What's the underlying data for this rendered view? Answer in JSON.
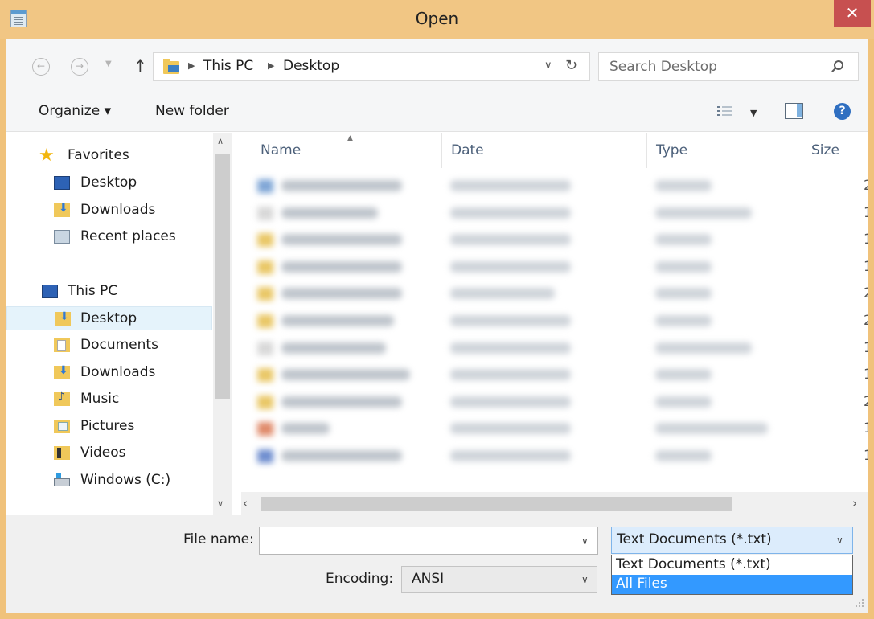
{
  "window": {
    "title": "Open",
    "close_label": "✕"
  },
  "address": {
    "crumbs": [
      "This PC",
      "Desktop"
    ],
    "search_placeholder": "Search Desktop"
  },
  "toolbar": {
    "organize_label": "Organize ▾",
    "new_folder_label": "New folder",
    "help_label": "?"
  },
  "nav": {
    "favorites_label": "Favorites",
    "favorites": [
      "Desktop",
      "Downloads",
      "Recent places"
    ],
    "this_pc_label": "This PC",
    "this_pc_items": [
      "Desktop",
      "Documents",
      "Downloads",
      "Music",
      "Pictures",
      "Videos",
      "Windows (C:)"
    ],
    "selected": "Desktop"
  },
  "filelist": {
    "columns": [
      "Name",
      "Date",
      "Type",
      "Size"
    ],
    "size_digits": [
      "2",
      "1",
      "1",
      "1",
      "2",
      "2",
      "1",
      "1",
      "2",
      "1",
      "1"
    ]
  },
  "bottom": {
    "file_name_label": "File name:",
    "file_name_value": "",
    "encoding_label": "Encoding:",
    "encoding_value": "ANSI",
    "file_type_value": "Text Documents (*.txt)",
    "file_type_options": [
      "Text Documents (*.txt)",
      "All Files"
    ],
    "highlighted_option": "All Files"
  },
  "colors": {
    "accent": "#3399ff",
    "titlebar": "#f1c684",
    "close": "#c75050"
  }
}
